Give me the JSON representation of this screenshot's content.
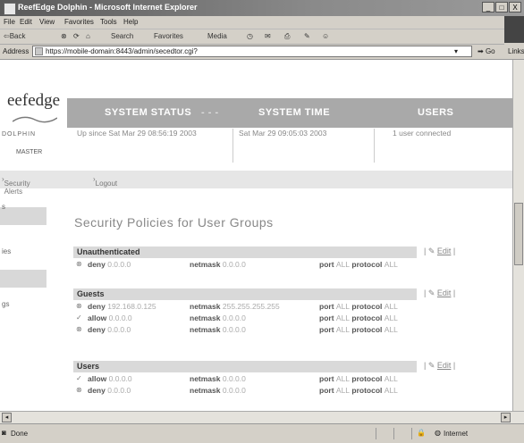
{
  "window": {
    "title": "ReefEdge Dolphin - Microsoft Internet Explorer",
    "buttons": [
      "_",
      "□",
      "X"
    ]
  },
  "menu": [
    "File",
    "Edit",
    "View",
    "Favorites",
    "Tools",
    "Help"
  ],
  "toolbar": {
    "back": "⇦Back",
    "search": "Search",
    "favorites": "Favorites",
    "media": "Media"
  },
  "address": {
    "label": "Address",
    "url": "https://mobile-domain:8443/admin/secedtor.cgi?",
    "go": "Go",
    "links": "Links"
  },
  "app": {
    "logo": "eefedge",
    "logo_sub": "DOLPHIN",
    "role": "MASTER",
    "header": {
      "status": "SYSTEM STATUS",
      "time": "SYSTEM TIME",
      "users": "USERS"
    },
    "status_value": "Up since Sat Mar 29 08:56:19 2003",
    "time_value": "Sat Mar 29 09:05:03 2003",
    "users_value": "1 user connected",
    "nav": {
      "alerts": "Security Alerts",
      "logout": "Logout"
    },
    "side": [
      "s",
      "ies",
      "gs"
    ]
  },
  "policies": {
    "title": "Security Policies for User Groups",
    "groups": [
      {
        "name": "Unauthenticated",
        "edit": "Edit",
        "rules": [
          {
            "mark": "⊗",
            "action": "deny",
            "ip": "0.0.0.0",
            "netmask": "0.0.0.0",
            "port": "ALL",
            "protocol": "ALL"
          }
        ]
      },
      {
        "name": "Guests",
        "edit": "Edit",
        "rules": [
          {
            "mark": "⊗",
            "action": "deny",
            "ip": "192.168.0.125",
            "netmask": "255.255.255.255",
            "port": "ALL",
            "protocol": "ALL"
          },
          {
            "mark": "✓",
            "action": "allow",
            "ip": "0.0.0.0",
            "netmask": "0.0.0.0",
            "port": "ALL",
            "protocol": "ALL"
          },
          {
            "mark": "⊗",
            "action": "deny",
            "ip": "0.0.0.0",
            "netmask": "0.0.0.0",
            "port": "ALL",
            "protocol": "ALL"
          }
        ]
      },
      {
        "name": "Users",
        "edit": "Edit",
        "rules": [
          {
            "mark": "✓",
            "action": "allow",
            "ip": "0.0.0.0",
            "netmask": "0.0.0.0",
            "port": "ALL",
            "protocol": "ALL"
          },
          {
            "mark": "⊗",
            "action": "deny",
            "ip": "0.0.0.0",
            "netmask": "0.0.0.0",
            "port": "ALL",
            "protocol": "ALL"
          }
        ]
      }
    ],
    "labels": {
      "netmask": "netmask",
      "port": "port",
      "protocol": "protocol"
    }
  },
  "statusbar": {
    "text": "Done",
    "zone": "Internet"
  }
}
